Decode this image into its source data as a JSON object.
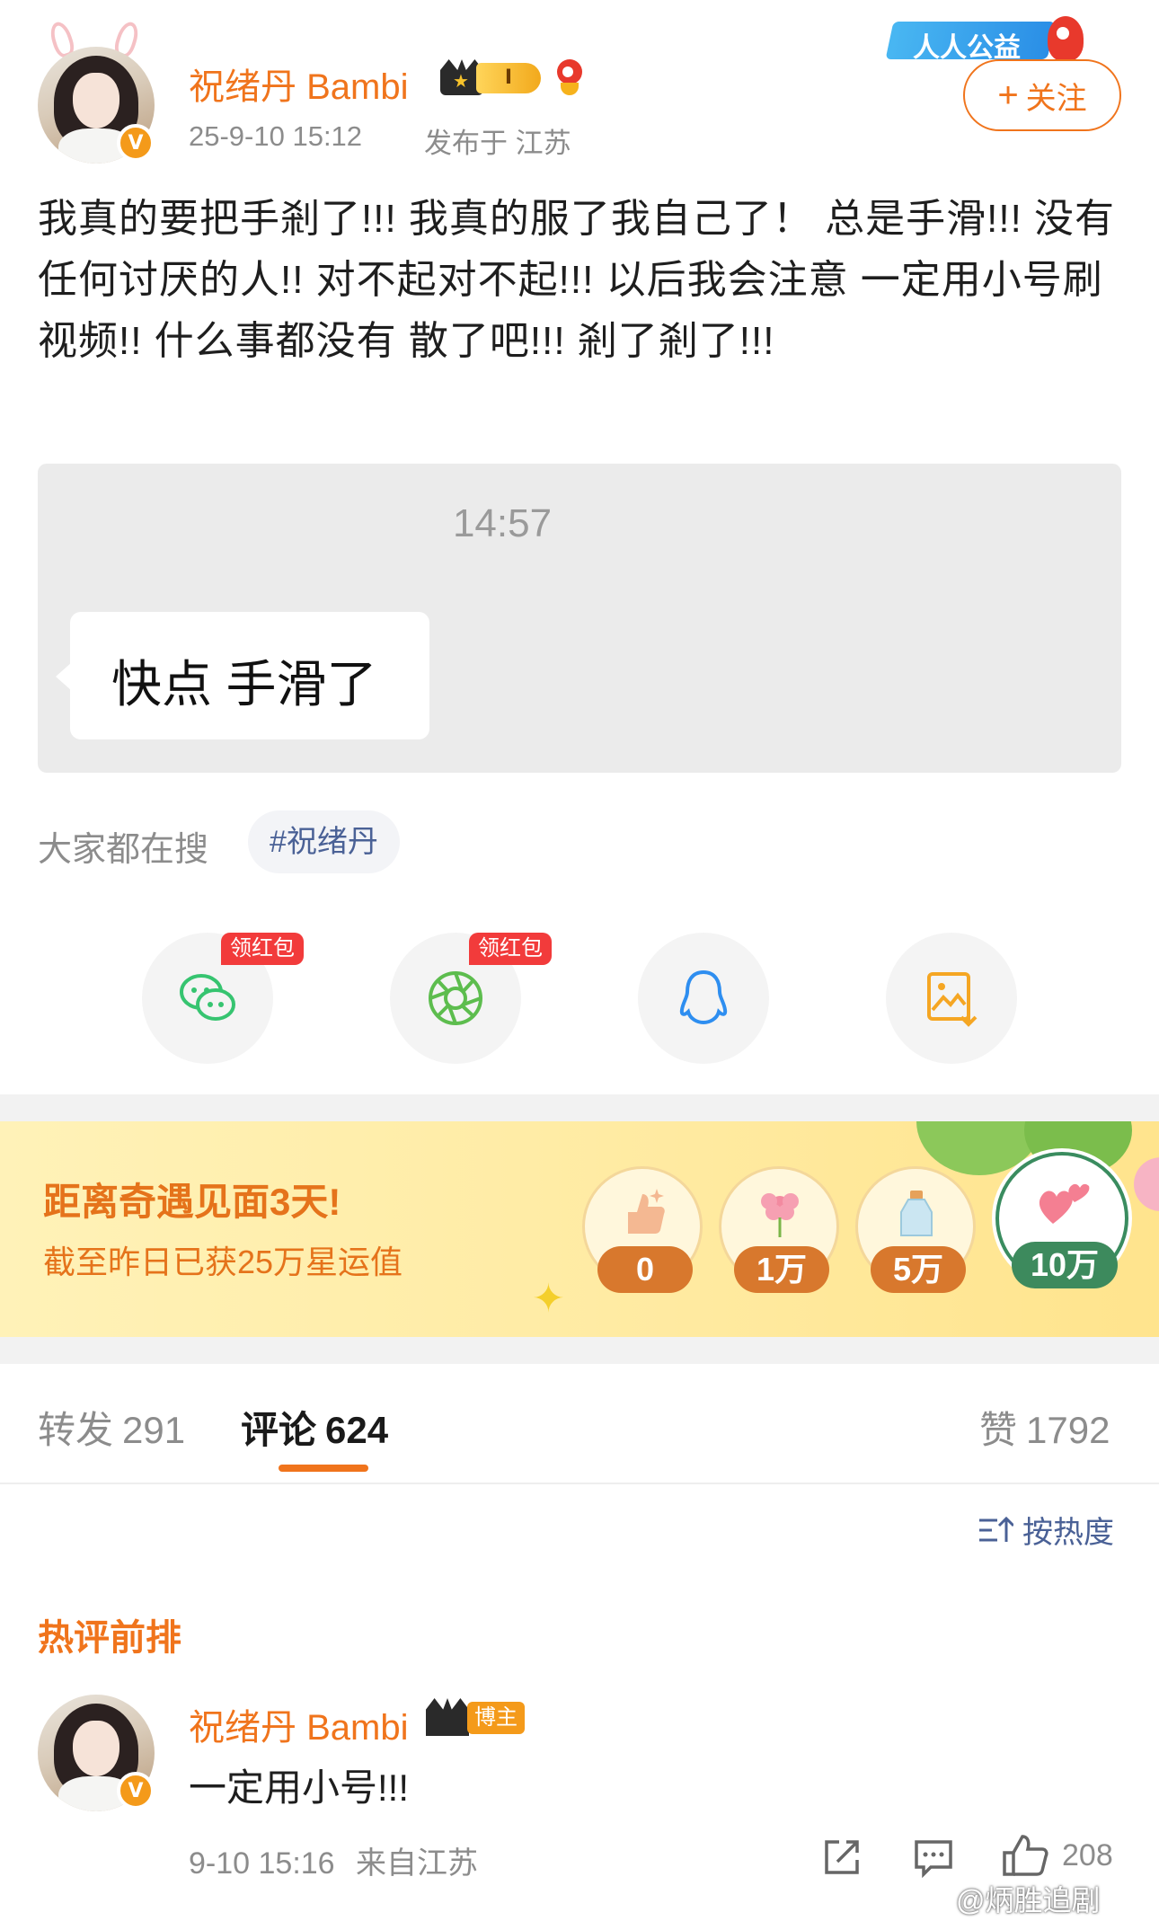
{
  "post": {
    "username": "祝绪丹 Bambi",
    "rank_badge": "I",
    "timestamp": "25-9-10 15:12",
    "location": "发布于 江苏",
    "charity_banner": "人人公益",
    "follow_label": "关注",
    "text": "我真的要把手剎了!!! 我真的服了我自己了！ 总是手滑!!! 没有任何讨厌的人!! 对不起对不起!!! 以后我会注意 一定用小号刷视频!! 什么事都没有 散了吧!!! 剎了剎了!!!",
    "image": {
      "time": "14:57",
      "message": "快点 手滑了"
    }
  },
  "search": {
    "label": "大家都在搜",
    "hashtag": "#祝绪丹"
  },
  "share": {
    "red_packet_label": "领红包",
    "buttons": [
      "wechat-icon",
      "moments-icon",
      "qq-icon",
      "save-image-icon"
    ]
  },
  "star_banner": {
    "title": "距离奇遇见面3天!",
    "subtitle": "截至昨日已获25万星运值",
    "milestones": [
      "0",
      "1万",
      "5万",
      "10万"
    ],
    "active_milestone": 3
  },
  "tabs": {
    "repost_label": "转发",
    "repost_count": "291",
    "comment_label": "评论",
    "comment_count": "624",
    "like_label": "赞",
    "like_count": "1792"
  },
  "sort_label": "按热度",
  "hot_comments_title": "热评前排",
  "comment": {
    "username": "祝绪丹 Bambi",
    "tag": "博主",
    "text": "一定用小号!!!",
    "time": "9-10 15:16",
    "location": "来自江苏",
    "like_count": "208"
  },
  "watermark": "@炳胜追剧",
  "colors": {
    "accent": "#f0741c",
    "link": "#4a6196",
    "banner": "#ffeaa0",
    "active_milestone": "#3d8a5d"
  }
}
